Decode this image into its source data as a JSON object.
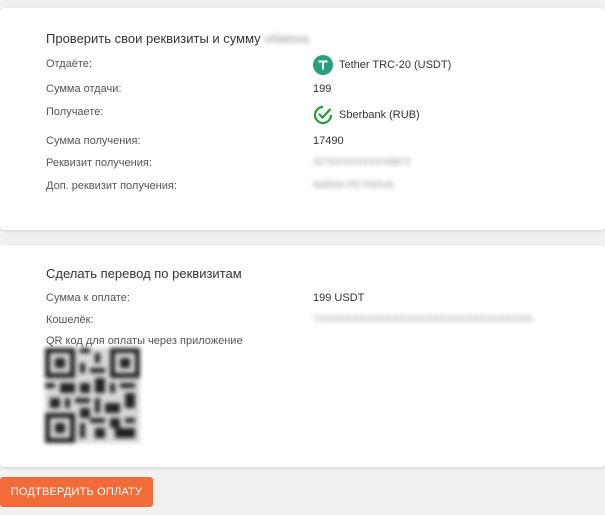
{
  "verify": {
    "title": "Проверить свои реквизиты и сумму",
    "title_hidden": "обмена",
    "rows": [
      {
        "label": "Отдаёте:",
        "value": "Tether TRC-20 (USDT)",
        "icon": "tether-icon"
      },
      {
        "label": "Сумма отдачи:",
        "value": "199"
      },
      {
        "label": "Получаете:",
        "value": "Sberbank (RUB)",
        "icon": "sberbank-icon"
      },
      {
        "label": "Сумма получения:",
        "value": "17490"
      },
      {
        "label": "Реквизит получения:",
        "value": "4276XXXXXXXX8872"
      },
      {
        "label": "Доп. реквизит получения:",
        "value": "MARIA PETROVA"
      }
    ]
  },
  "transfer": {
    "title": "Сделать перевод по реквизитам",
    "rows": [
      {
        "label": "Сумма к оплате:",
        "value": "199 USDT"
      },
      {
        "label": "Кошелёк:",
        "value": "TXXXXXXXXXXXXXXXXXXXXXXXXXXXXXXXX"
      }
    ],
    "qr_label": "QR код для оплаты через приложение"
  },
  "confirm_button": "ПОДТВЕРДИТЬ ОПЛАТУ",
  "colors": {
    "accent": "#f26c3a",
    "tether": "#26a17b",
    "sberbank": "#21a038"
  }
}
